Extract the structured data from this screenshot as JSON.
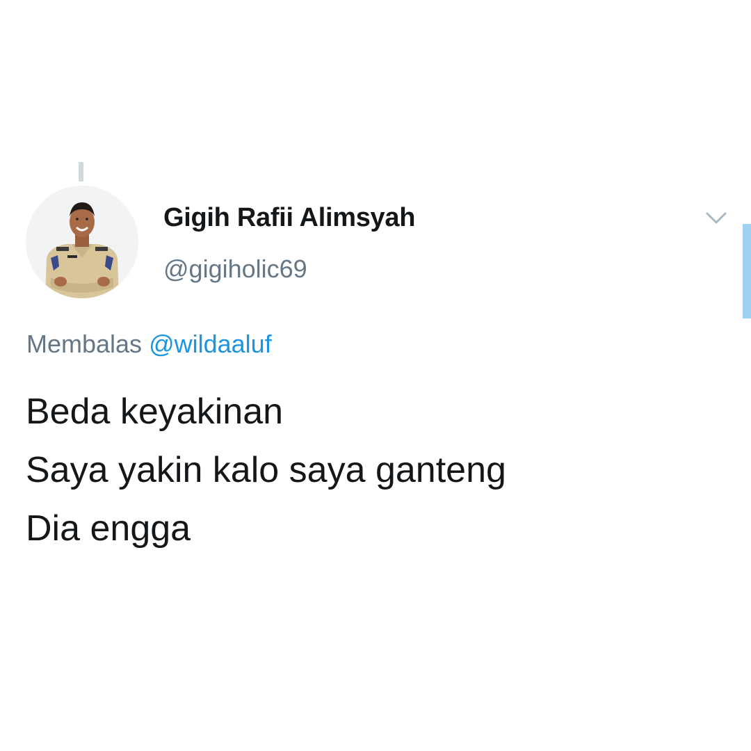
{
  "user": {
    "display_name": "Gigih Rafii Alimsyah",
    "handle": "@gigiholic69"
  },
  "reply": {
    "prefix": "Membalas",
    "mention": "@wildaaluf"
  },
  "tweet": {
    "lines": [
      "Beda keyakinan",
      "Saya yakin kalo saya ganteng",
      "Dia engga"
    ]
  },
  "icons": {
    "more": "chevron-down-icon"
  },
  "colors": {
    "name": "#14171a",
    "secondary": "#657786",
    "link": "#1b95e0",
    "thread_line": "#cfd9de",
    "scrollbar": "#9fd2f2"
  }
}
